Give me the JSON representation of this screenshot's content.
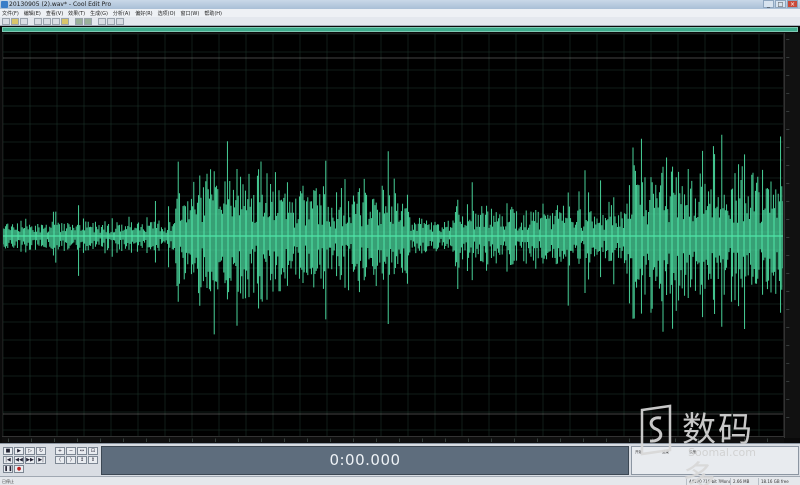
{
  "window": {
    "title": "20130905 (2).wav* - Cool Edit Pro",
    "controls": [
      "minimize",
      "maximize",
      "close"
    ]
  },
  "menu": {
    "items": [
      "文件(F)",
      "编辑(E)",
      "查看(V)",
      "效果(T)",
      "生成(G)",
      "分析(A)",
      "偏好(R)",
      "选项(O)",
      "窗口(W)",
      "帮助(H)"
    ]
  },
  "toolbar": {
    "icons": [
      "new-file-icon",
      "open-file-icon",
      "save-icon",
      "cut-icon",
      "copy-icon",
      "paste-icon",
      "undo-icon",
      "redo-icon",
      "mix-paste-icon",
      "crop-icon",
      "zoom-icon",
      "settings-icon"
    ]
  },
  "waveform": {
    "color": "#4fe6a8",
    "background": "#000000",
    "grid_color": "#1e3a2e"
  },
  "display": {
    "time": "0:00.000"
  },
  "status": {
    "left": "已停止",
    "sample_info": "44100 ?16-bit ?Mono",
    "size": "2.66 MB",
    "free": "18.16 GB free"
  },
  "watermark": {
    "brand_cn": "数码多",
    "brand_en": "Soomal.com"
  }
}
